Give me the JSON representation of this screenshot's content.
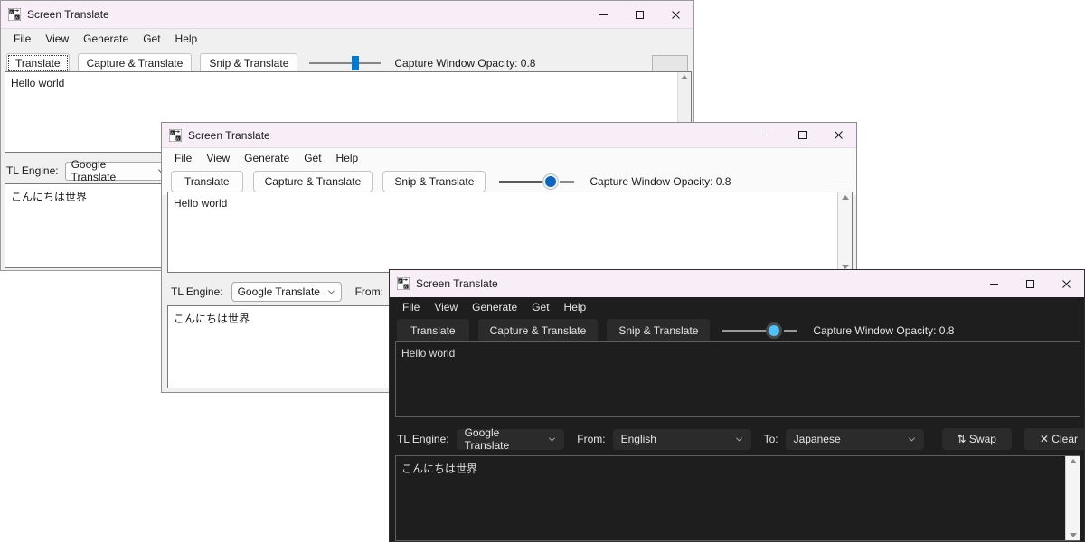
{
  "app": {
    "title": "Screen Translate",
    "icon": "app-icon"
  },
  "menu": [
    "File",
    "View",
    "Generate",
    "Get",
    "Help"
  ],
  "window_controls": {
    "minimize": "minimize-icon",
    "maximize": "maximize-icon",
    "close": "close-icon"
  },
  "toolbar": {
    "translate": "Translate",
    "capture_translate": "Capture & Translate",
    "snip_translate": "Snip & Translate",
    "opacity_label": "Capture Window Opacity: 0.8",
    "opacity_value": 0.8
  },
  "source_text": "Hello world",
  "result_text": "こんにちは世界",
  "controls": {
    "tl_engine_label": "TL Engine:",
    "tl_engine_value": "Google Translate",
    "from_label": "From:",
    "from_value": "English",
    "to_label": "To:",
    "to_value": "Japanese",
    "swap_label": "⇅ Swap",
    "clear_label": "✕ Clear"
  },
  "colors": {
    "accent_light": "#0078d4",
    "accent_mid": "#0a66c2",
    "accent_dark": "#4fc3f7",
    "titlebar_light": "#f7eef7",
    "dark_bg": "#1e1e1e",
    "dark_control": "#2b2b2b"
  },
  "windows": [
    {
      "theme": "light-classic",
      "label": "window-1-classic"
    },
    {
      "theme": "light-modern",
      "label": "window-2-modern"
    },
    {
      "theme": "dark",
      "label": "window-3-dark"
    }
  ]
}
